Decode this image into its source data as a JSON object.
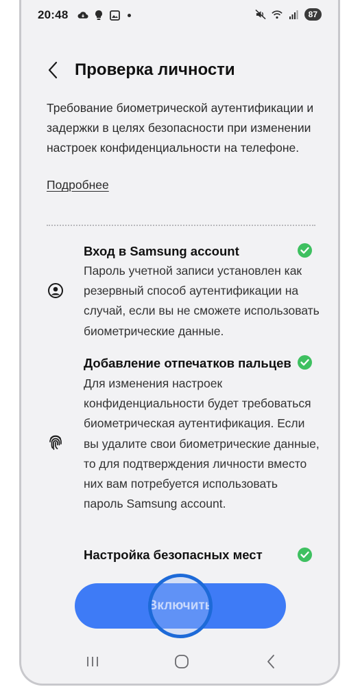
{
  "status_bar": {
    "time": "20:48",
    "battery": "87",
    "left_icons": [
      "cloud-sync-icon",
      "lightbulb-icon",
      "image-icon",
      "dot-icon"
    ],
    "right_icons": [
      "mute-icon",
      "wifi-icon",
      "signal-icon"
    ]
  },
  "header": {
    "back_icon": "chevron-left-icon",
    "title": "Проверка личности"
  },
  "description": "Требование биометрической аутентификации и задержки в целях безопасности при изменении настроек конфиденциальности на телефоне.",
  "more_link": "Подробнее",
  "items": [
    {
      "icon": "account-icon",
      "title": "Вход в Samsung account",
      "description": "Пароль учетной записи установлен как резервный способ аутентификации на случай, если вы не сможете использовать биометрические данные.",
      "status": "check-icon"
    },
    {
      "icon": "fingerprint-icon",
      "title": "Добавление отпечатков пальцев",
      "description": "Для изменения настроек конфиденциальности будет требоваться биометрическая аутентификация. Если вы удалите свои биометрические данные, то для подтверждения личности вместо них вам потребуется использовать пароль Samsung account.",
      "status": "check-icon"
    },
    {
      "icon": "",
      "title": "Настройка безопасных мест",
      "description": "",
      "status": "check-icon"
    }
  ],
  "enable_button": "Включить",
  "navigation": [
    "recents-icon",
    "home-icon",
    "back-icon"
  ],
  "colors": {
    "background": "#f2f2f4",
    "accent": "#3e7bf6",
    "check": "#3ec060"
  }
}
